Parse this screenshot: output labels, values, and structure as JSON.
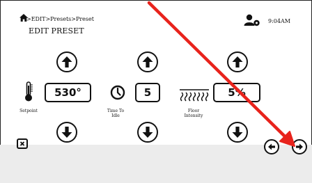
{
  "header": {
    "breadcrumb": ">EDIT>Presets>Preset",
    "title": "EDIT PRESET",
    "time": "9:04AM"
  },
  "controls": [
    {
      "name": "setpoint",
      "value": "530°",
      "label": "Setpoint"
    },
    {
      "name": "time-to-idle",
      "value": "5",
      "label": "Time To Idle"
    },
    {
      "name": "floor-intensity",
      "value": "5%",
      "label": "Floor Intensity"
    }
  ],
  "icons": {
    "home": "home-icon",
    "user_settings": "user-gear-icon",
    "thermometer": "thermometer-icon",
    "clock": "clock-icon",
    "heat": "heat-waves-icon",
    "close": "close-icon",
    "prev": "arrow-left-icon",
    "next": "arrow-right-icon",
    "annotation": "red-pointer-arrow"
  },
  "colors": {
    "annotation": "#e8231c",
    "footer": "#ececec"
  }
}
